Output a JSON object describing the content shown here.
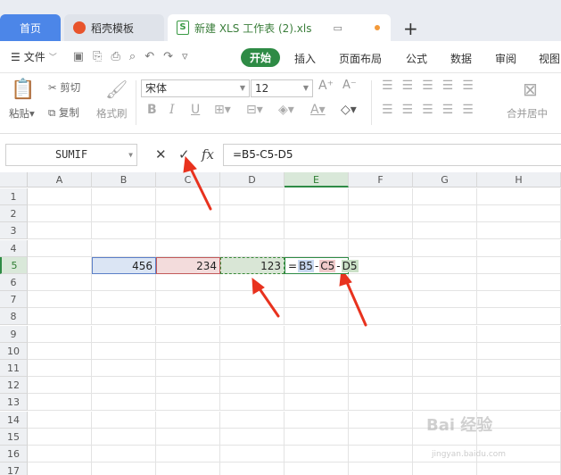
{
  "tabs": [
    {
      "label": "首页"
    },
    {
      "label": "稻壳模板"
    },
    {
      "label": "新建 XLS 工作表 (2).xls"
    }
  ],
  "menu": {
    "file": "文件",
    "items": [
      "开始",
      "插入",
      "页面布局",
      "公式",
      "数据",
      "审阅",
      "视图"
    ]
  },
  "ribbon": {
    "paste": "粘贴",
    "cut": "剪切",
    "copy": "复制",
    "format_painter": "格式刷",
    "font_name": "宋体",
    "font_size": "12",
    "merge_center": "合并居中"
  },
  "formula_bar": {
    "name_box": "SUMIF",
    "formula": "=B5-C5-D5"
  },
  "columns": [
    "A",
    "B",
    "C",
    "D",
    "E",
    "F",
    "G",
    "H"
  ],
  "rows": [
    "1",
    "2",
    "3",
    "4",
    "5",
    "6",
    "7",
    "8",
    "9",
    "10",
    "11",
    "12",
    "13",
    "14",
    "15",
    "16",
    "17"
  ],
  "cells": {
    "B5": "456",
    "C5": "234",
    "D5": "123",
    "E5_parts": [
      "=",
      "B5",
      "-",
      "C5",
      "-",
      "D5"
    ]
  },
  "selected": {
    "column": "E",
    "row": "5"
  },
  "colors": {
    "accent": "#2e8b45",
    "home_tab": "#4c86e8",
    "ref_b": "#5b7fc7",
    "ref_c": "#c25a5a",
    "ref_d": "#3a8a3a",
    "arrow": "#e8321e"
  },
  "watermark": {
    "main": "Bai 经验",
    "sub": "jingyan.baidu.com"
  }
}
